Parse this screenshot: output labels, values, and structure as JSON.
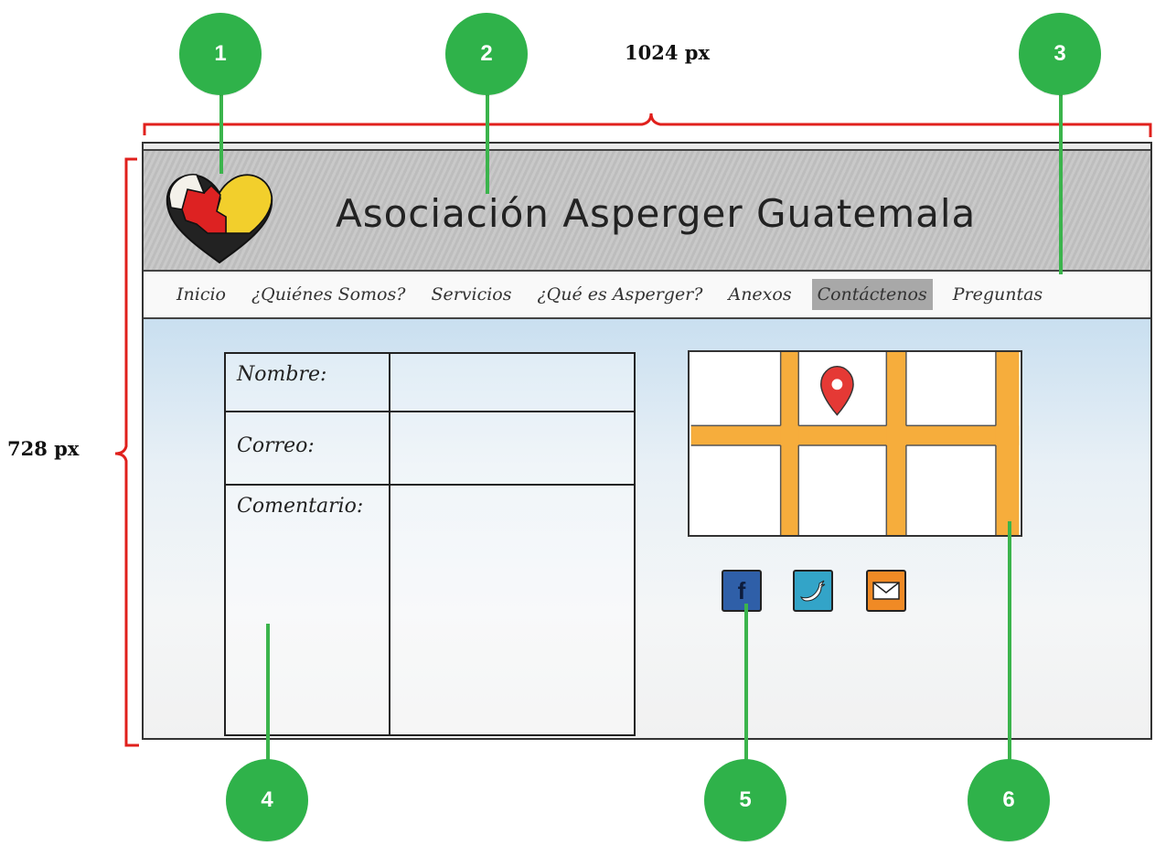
{
  "dimensions": {
    "width_label": "1024 px",
    "height_label": "728 px",
    "bracket_color": "#e0201c"
  },
  "markers": [
    "1",
    "2",
    "3",
    "4",
    "5",
    "6"
  ],
  "marker_color": "#2fb24a",
  "header": {
    "title": "Asociación Asperger Guatemala",
    "logo": "puzzle-heart-logo"
  },
  "nav": {
    "items": [
      "Inicio",
      "¿Quiénes Somos?",
      "Servicios",
      "¿Qué es Asperger?",
      "Anexos",
      "Contáctenos",
      "Preguntas"
    ],
    "active_index": 5
  },
  "form": {
    "name_label": "Nombre:",
    "email_label": "Correo:",
    "comment_label": "Comentario:"
  },
  "map": {
    "street_color": "#f6ad3c",
    "pin_color": "#e53935",
    "icon": "map-pin-icon"
  },
  "social": [
    {
      "name": "facebook",
      "icon": "facebook-icon",
      "color": "#2f5fa8"
    },
    {
      "name": "twitter",
      "icon": "twitter-bird-icon",
      "color": "#33a4c8"
    },
    {
      "name": "email",
      "icon": "envelope-icon",
      "color": "#f08a25"
    }
  ]
}
